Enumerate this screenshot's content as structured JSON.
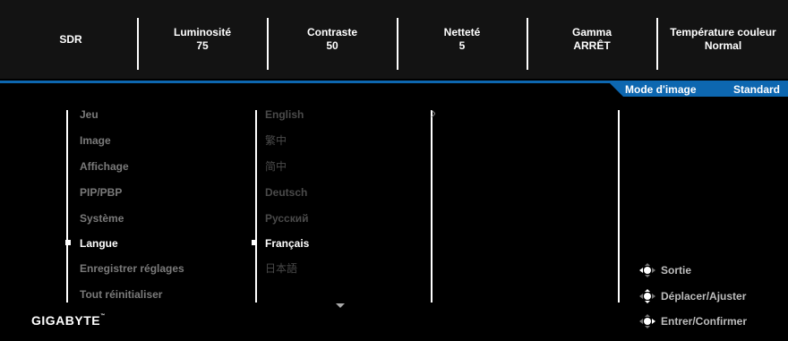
{
  "top_bar": {
    "items": [
      {
        "label": "SDR",
        "value": ""
      },
      {
        "label": "Luminosité",
        "value": "75"
      },
      {
        "label": "Contraste",
        "value": "50"
      },
      {
        "label": "Netteté",
        "value": "5"
      },
      {
        "label": "Gamma",
        "value": "ARRÊT"
      },
      {
        "label": "Température couleur",
        "value": "Normal"
      }
    ]
  },
  "mode": {
    "label": "Mode d'image",
    "value": "Standard"
  },
  "menu": {
    "items": [
      "Jeu",
      "Image",
      "Affichage",
      "PIP/PBP",
      "Système",
      "Langue",
      "Enregistrer réglages",
      "Tout réinitialiser"
    ],
    "selected": "Langue"
  },
  "languages": {
    "items": [
      "English",
      "繁中",
      "简中",
      "Deutsch",
      "Русский",
      "Français",
      "日本語"
    ],
    "selected": "Français"
  },
  "brand": {
    "name": "GIGABYTE",
    "mark": "™"
  },
  "hints": {
    "exit": "Sortie",
    "move": "Déplacer/Ajuster",
    "enter": "Entrer/Confirmer"
  },
  "colors": {
    "accent": "#0d67b0",
    "background": "#000000",
    "topbar": "#131313"
  },
  "icons": {
    "joystick": "joystick-icon",
    "more": "chevron-down-icon"
  }
}
